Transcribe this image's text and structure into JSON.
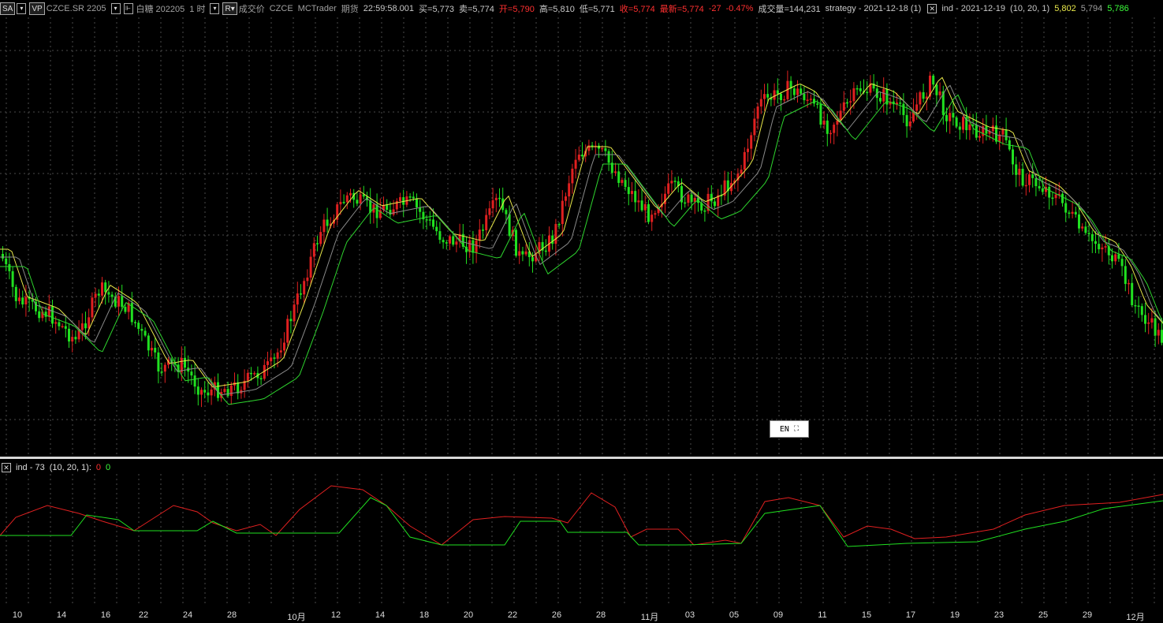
{
  "toolbar": {
    "sa_label": "SA",
    "vp_label": "VP",
    "symbol": "CZCE.SR 2205",
    "contract": "白糖 202205",
    "interval": "1 时",
    "r_label": "R",
    "price_type": "成交价",
    "exchange": "CZCE",
    "source": "MCTrader",
    "category": "期货",
    "time": "22:59:58.001",
    "bid": "买=5,773",
    "ask": "卖=5,774",
    "open": "开=5,790",
    "high": "高=5,810",
    "low": "低=5,771",
    "close": "收=5,774",
    "last": "最新=5,774",
    "change": "-27",
    "change_pct": "-0.47%",
    "volume": "成交量=144,231",
    "strategy": "strategy - 2021-12-18 (1)",
    "ind": "ind - 2021-12-19",
    "ind_params": "(10,  20,  1)",
    "ind_v1": "5,802",
    "ind_v2": "5,794",
    "ind_v3": "5,786"
  },
  "indicator_panel": {
    "title": "ind - 73",
    "params": "(10,  20,  1):",
    "v1": "0",
    "v2": "0"
  },
  "ime_badge": "EN",
  "xaxis_labels": [
    "10",
    "14",
    "16",
    "22",
    "24",
    "28",
    "10月",
    "12",
    "14",
    "18",
    "20",
    "22",
    "26",
    "28",
    "11月",
    "03",
    "05",
    "09",
    "11",
    "15",
    "17",
    "19",
    "23",
    "25",
    "29",
    "12月"
  ],
  "colors": {
    "bull": "#e02020",
    "bear": "#20e020",
    "ma_fast": "#e8e84a",
    "ma_mid": "#8a8a8a",
    "ma_slow": "#2ed62e",
    "ind_red": "#e02020",
    "ind_green": "#20e020",
    "grid": "#4a4a4a"
  }
}
